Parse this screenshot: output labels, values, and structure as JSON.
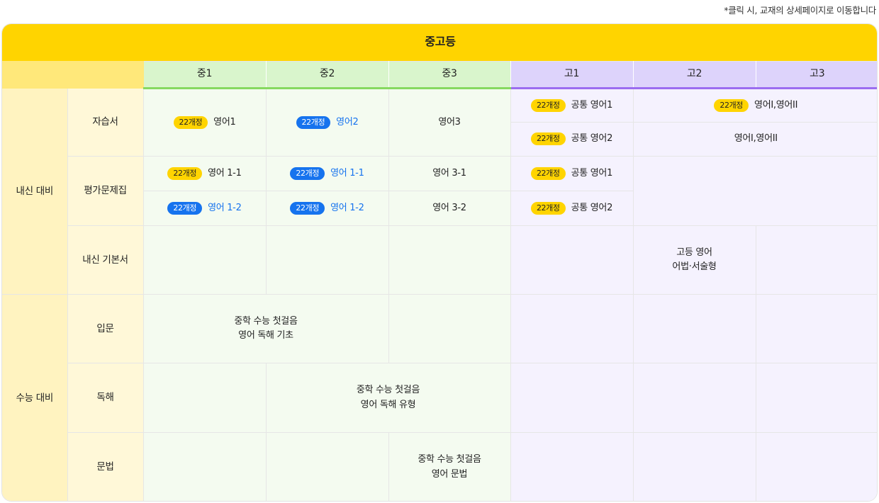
{
  "note": "*클릭 시, 교재의 상세페이지로 이동합니다",
  "table_title": "중고등",
  "grades": {
    "m1": "중1",
    "m2": "중2",
    "m3": "중3",
    "h1": "고1",
    "h2": "고2",
    "h3": "고3"
  },
  "categories": {
    "naesin": "내신 대비",
    "suneung": "수능 대비"
  },
  "subcats": {
    "jaseupseo": "자습서",
    "pyeongga": "평가문제집",
    "gibonseo": "내신 기본서",
    "ipmun": "입문",
    "dokhae": "독해",
    "munbeop": "문법"
  },
  "badge": "22개정",
  "colors": {
    "title_bg": "#ffd400",
    "badge_blue": "#1673ee",
    "middle_header": "#d9f5cc",
    "high_header": "#ddd3fb"
  },
  "cells": {
    "jaseupseo_m1": "영어1",
    "jaseupseo_m2": "영어2",
    "jaseupseo_m3": "영어3",
    "jaseupseo_h1_a": "공통 영어1",
    "jaseupseo_h1_b": "공통 영어2",
    "jaseupseo_h23_a": "영어I,영어II",
    "jaseupseo_h23_b": "영어I,영어II",
    "pyeongga_m1_a": "영어 1-1",
    "pyeongga_m1_b": "영어 1-2",
    "pyeongga_m2_a": "영어 1-1",
    "pyeongga_m2_b": "영어 1-2",
    "pyeongga_m3_a": "영어 3-1",
    "pyeongga_m3_b": "영어 3-2",
    "pyeongga_h1_a": "공통 영어1",
    "pyeongga_h1_b": "공통 영어2",
    "gibonseo_h2_line1": "고등 영어",
    "gibonseo_h2_line2": "어법·서술형",
    "ipmun_line1": "중학 수능 첫걸음",
    "ipmun_line2": "영어 독해 기초",
    "dokhae_line1": "중학 수능 첫걸음",
    "dokhae_line2": "영어 독해 유형",
    "munbeop_line1": "중학 수능 첫걸음",
    "munbeop_line2": "영어 문법"
  }
}
